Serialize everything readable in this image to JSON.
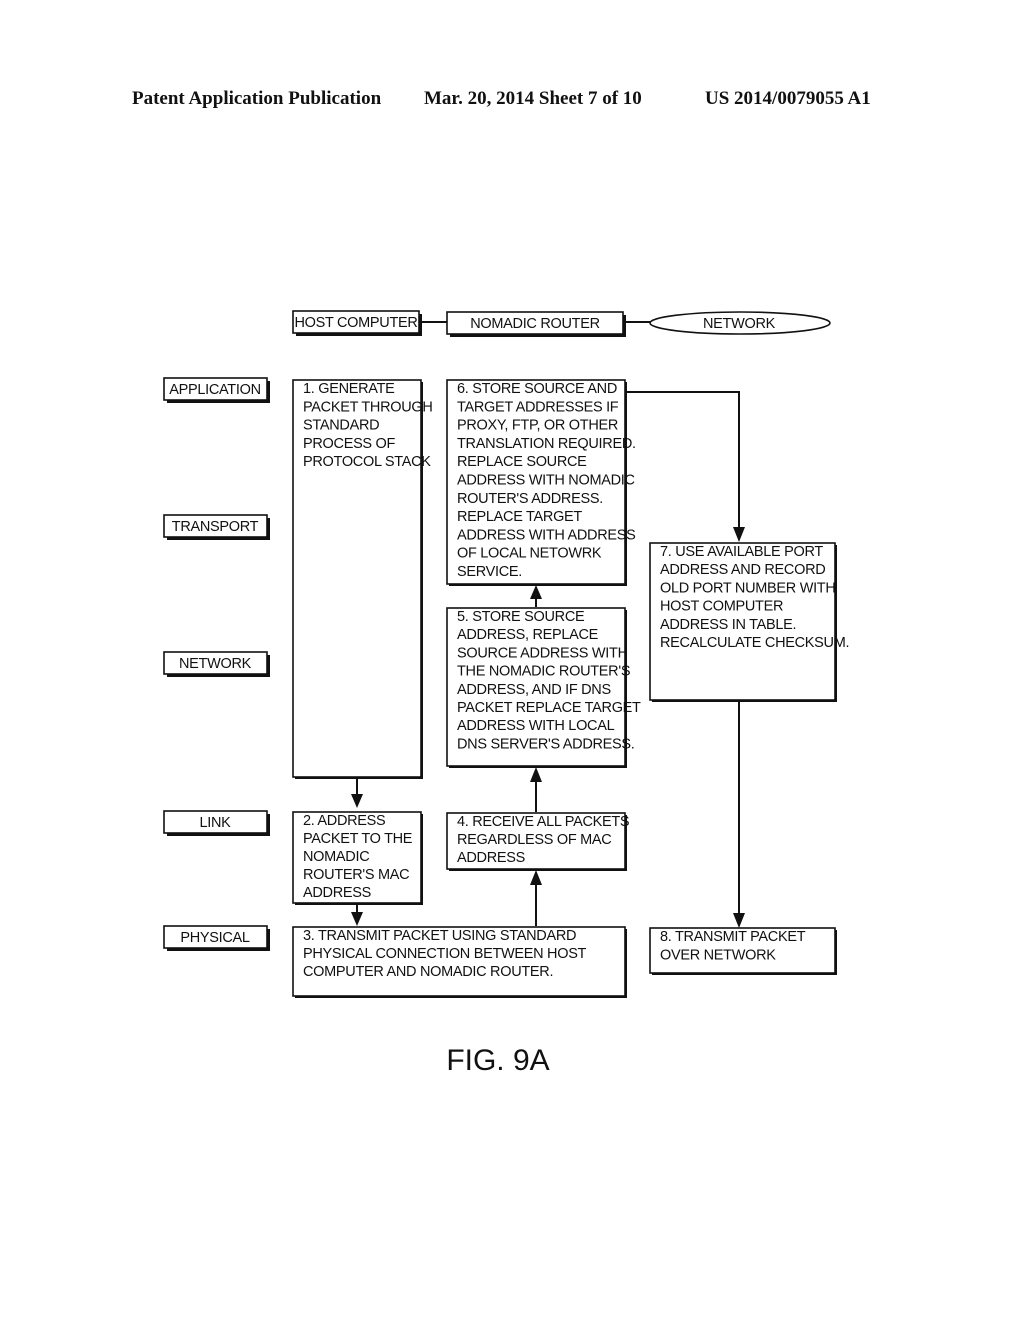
{
  "header": {
    "left": "Patent Application Publication",
    "middle": "Mar. 20, 2014  Sheet 7 of 10",
    "right": "US 2014/0079055 A1"
  },
  "entities": {
    "host": "HOST COMPUTER",
    "router": "NOMADIC ROUTER",
    "network": "NETWORK"
  },
  "layers": [
    "APPLICATION",
    "TRANSPORT",
    "NETWORK",
    "LINK",
    "PHYSICAL"
  ],
  "steps": [
    {
      "id": "1",
      "lines": [
        "1.  GENERATE",
        "PACKET THROUGH",
        "STANDARD",
        "PROCESS OF",
        "PROTOCOL STACK"
      ]
    },
    {
      "id": "2",
      "lines": [
        "2.  ADDRESS",
        "PACKET TO THE",
        "NOMADIC",
        "ROUTER'S MAC",
        "ADDRESS"
      ]
    },
    {
      "id": "3",
      "lines": [
        "3.  TRANSMIT PACKET USING STANDARD",
        "PHYSICAL CONNECTION BETWEEN HOST",
        "COMPUTER AND NOMADIC ROUTER."
      ]
    },
    {
      "id": "4",
      "lines": [
        "4.  RECEIVE ALL PACKETS",
        "REGARDLESS OF MAC",
        "ADDRESS"
      ]
    },
    {
      "id": "5",
      "lines": [
        "5.  STORE SOURCE",
        "ADDRESS, REPLACE",
        "SOURCE ADDRESS WITH",
        "THE NOMADIC ROUTER'S",
        "ADDRESS, AND IF DNS",
        "PACKET REPLACE TARGET",
        "ADDRESS WITH LOCAL",
        "DNS SERVER'S ADDRESS."
      ]
    },
    {
      "id": "6",
      "lines": [
        "6.  STORE SOURCE AND",
        "TARGET ADDRESSES IF",
        "PROXY, FTP, OR OTHER",
        "TRANSLATION REQUIRED.",
        "REPLACE SOURCE",
        "ADDRESS WITH NOMADIC",
        "ROUTER'S ADDRESS.",
        "REPLACE TARGET",
        "ADDRESS WITH ADDRESS",
        "OF LOCAL NETOWRK",
        "SERVICE."
      ]
    },
    {
      "id": "7",
      "lines": [
        "7.  USE AVAILABLE PORT",
        "ADDRESS AND RECORD",
        "OLD PORT NUMBER WITH",
        "HOST COMPUTER",
        "ADDRESS IN TABLE.",
        "RECALCULATE CHECKSUM."
      ]
    },
    {
      "id": "8",
      "lines": [
        "8.  TRANSMIT PACKET",
        "OVER NETWORK"
      ]
    }
  ],
  "flow": [
    {
      "from": "1",
      "to": "2"
    },
    {
      "from": "2",
      "to": "3"
    },
    {
      "from": "3",
      "to": "4"
    },
    {
      "from": "4",
      "to": "5"
    },
    {
      "from": "5",
      "to": "6"
    },
    {
      "from": "6",
      "to": "7"
    },
    {
      "from": "7",
      "to": "8"
    }
  ],
  "figure_label": "FIG. 9A"
}
